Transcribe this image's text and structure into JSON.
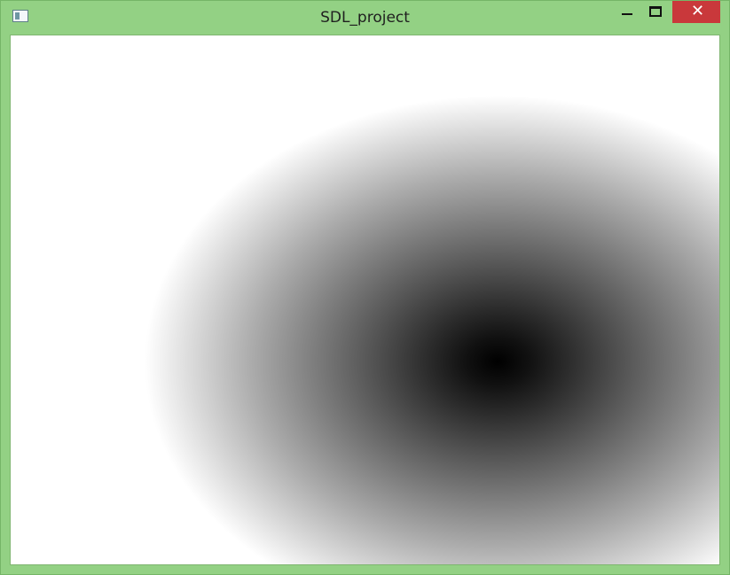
{
  "window": {
    "title": "SDL_project",
    "icon": "app-window-icon",
    "controls": {
      "minimize_icon": "minimize-icon",
      "maximize_icon": "maximize-icon",
      "close_icon": "close-icon",
      "close_symbol": "✕"
    },
    "colors": {
      "frame": "#93d184",
      "close_button": "#c9383b",
      "canvas_background": "#ffffff",
      "gradient_center": "#000000"
    }
  },
  "canvas": {
    "content": "radial-gradient"
  }
}
